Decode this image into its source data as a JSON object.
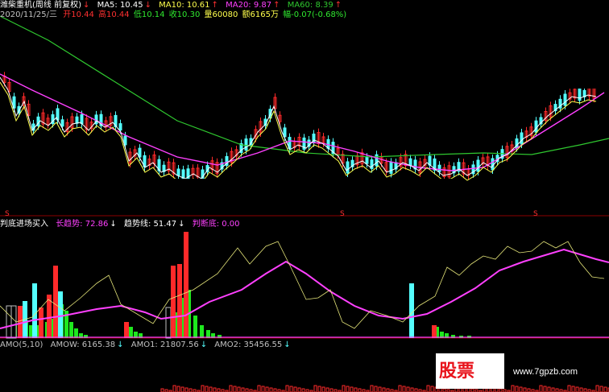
{
  "header": {
    "title": "潍柴重机(周线 前复权)",
    "ma5": "MA5: 10.45",
    "ma10": "MA10: 10.61",
    "ma20": "MA20: 9.87",
    "ma60": "MA60: 8.39",
    "date": "2020/11/25/三",
    "open": "开10.44",
    "high": "高10.44",
    "low": "低10.14",
    "close": "收10.30",
    "volume": "量60080",
    "amount": "额6165万",
    "change": "幅-0.07(-0.68%)"
  },
  "indicator": {
    "title": "判底进场买入",
    "long_trend": "长趋势: 72.86",
    "trend_line": "趋势线: 51.47",
    "bottom": "判断底: 0.00"
  },
  "volume_panel": {
    "amo": "AMO(5,10)",
    "amow": "AMOW: 6165.38",
    "amo1": "AMO1: 21807.56",
    "amo2": "AMO2: 35456.55"
  },
  "watermark": {
    "logo_text": "股票",
    "url": "www.7gpzb.com"
  },
  "colors": {
    "up": "#ff2a2a",
    "down": "#54ffff",
    "ma5": "#ffffff",
    "ma10": "#ffff4c",
    "ma20": "#ff40ff",
    "ma60": "#2fc82f",
    "green_bar": "#1ee81e",
    "arrow": "#ff3030"
  },
  "icons": [
    "arrow-up-icon",
    "arrow-down-icon",
    "s-marker-icon"
  ]
}
